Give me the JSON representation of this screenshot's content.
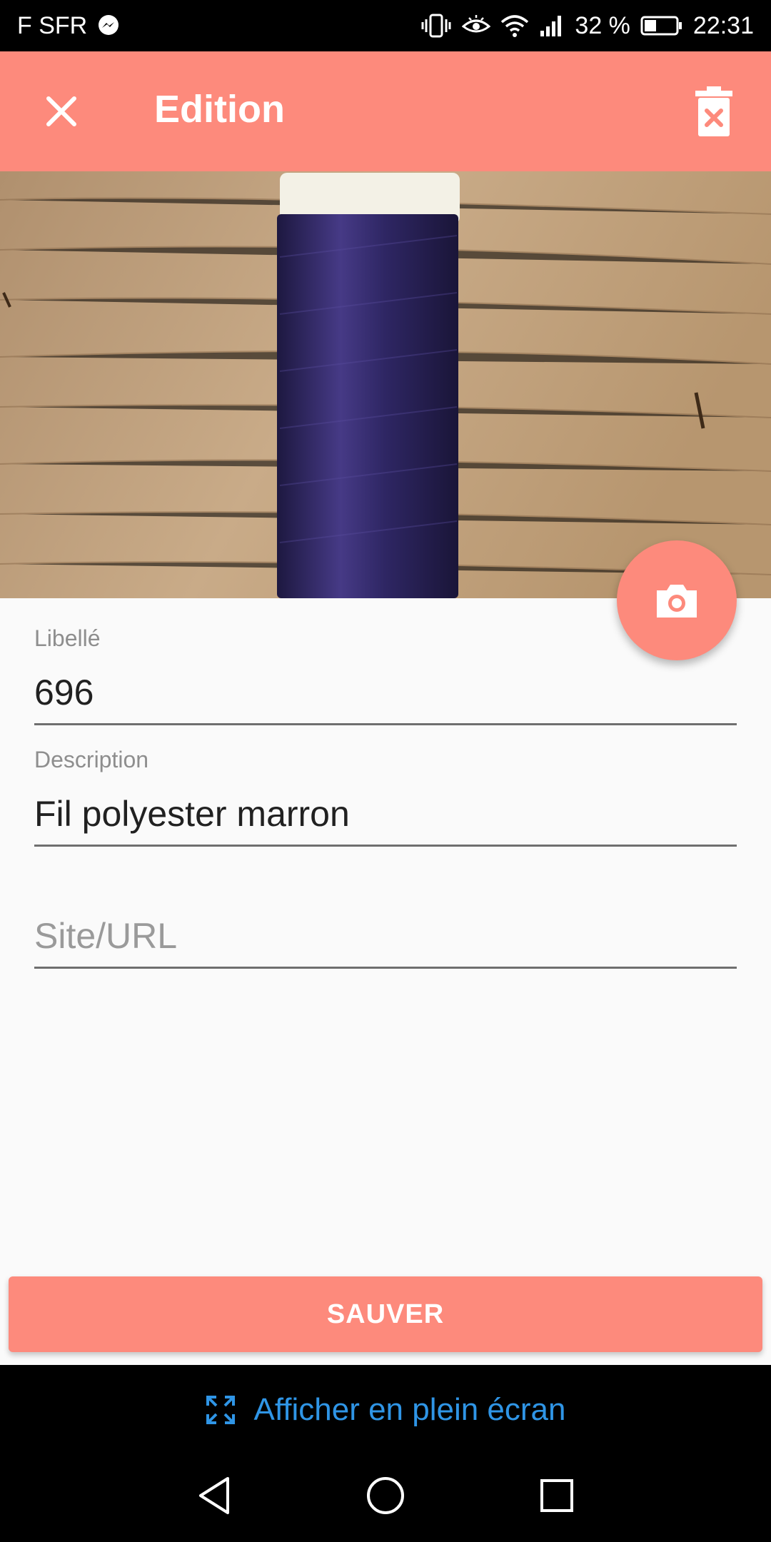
{
  "status_bar": {
    "carrier": "F SFR",
    "battery_percent": "32 %",
    "time": "22:31",
    "icons": [
      "messenger-icon",
      "vibrate-icon",
      "eye-comfort-icon",
      "wifi-icon",
      "signal-icon",
      "battery-icon"
    ]
  },
  "app_bar": {
    "title": "Edition",
    "close_icon": "close-icon",
    "delete_icon": "delete-icon"
  },
  "photo": {
    "subject": "spool-photo",
    "camera_icon": "camera-icon"
  },
  "form": {
    "libelle_label": "Libellé",
    "libelle_value": "696",
    "description_label": "Description",
    "description_value": "Fil polyester marron",
    "site_placeholder": "Site/URL"
  },
  "actions": {
    "save_label": "SAUVER"
  },
  "fullscreen_banner": {
    "label": "Afficher en plein écran",
    "icon": "expand-icon"
  },
  "nav": {
    "back_icon": "back-icon",
    "home_icon": "home-icon",
    "recents_icon": "recents-icon"
  },
  "colors": {
    "accent": "#fd8a7c",
    "link": "#2f95e6",
    "background": "#fafafa"
  }
}
